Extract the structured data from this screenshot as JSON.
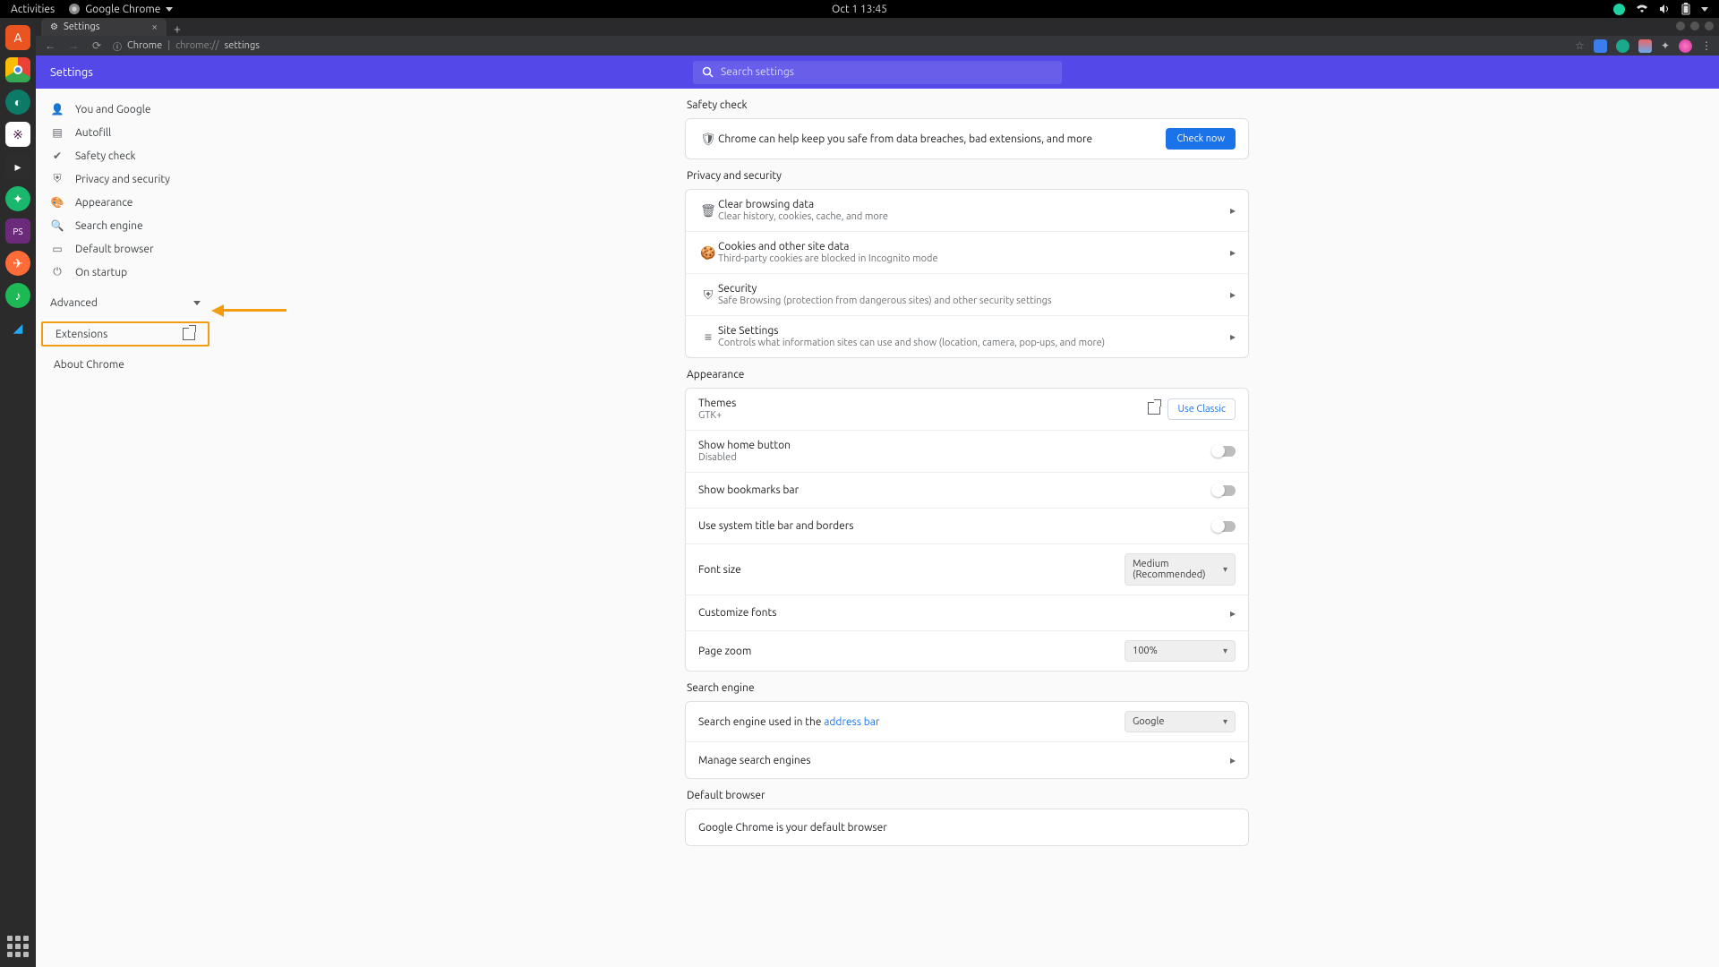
{
  "gnome": {
    "activities": "Activities",
    "app_name": "Google Chrome",
    "clock": "Oct 1  13:45"
  },
  "chrome": {
    "tab_title": "Settings",
    "url_prefix": "Chrome",
    "url_sep": " | ",
    "url_dim": "chrome://",
    "url_path": "settings"
  },
  "settings": {
    "title": "Settings",
    "search_placeholder": "Search settings"
  },
  "sidebar": {
    "items": [
      {
        "label": "You and Google",
        "icon": "person"
      },
      {
        "label": "Autofill",
        "icon": "autofill"
      },
      {
        "label": "Safety check",
        "icon": "shield-check"
      },
      {
        "label": "Privacy and security",
        "icon": "shield"
      },
      {
        "label": "Appearance",
        "icon": "palette"
      },
      {
        "label": "Search engine",
        "icon": "search"
      },
      {
        "label": "Default browser",
        "icon": "browser"
      },
      {
        "label": "On startup",
        "icon": "power"
      }
    ],
    "advanced": "Advanced",
    "extensions": "Extensions",
    "about": "About Chrome"
  },
  "sections": {
    "safety": {
      "title": "Safety check",
      "desc": "Chrome can help keep you safe from data breaches, bad extensions, and more",
      "button": "Check now"
    },
    "privacy": {
      "title": "Privacy and security",
      "rows": [
        {
          "title": "Clear browsing data",
          "sub": "Clear history, cookies, cache, and more",
          "icon": "trash"
        },
        {
          "title": "Cookies and other site data",
          "sub": "Third-party cookies are blocked in Incognito mode",
          "icon": "cookie"
        },
        {
          "title": "Security",
          "sub": "Safe Browsing (protection from dangerous sites) and other security settings",
          "icon": "shield"
        },
        {
          "title": "Site Settings",
          "sub": "Controls what information sites can use and show (location, camera, pop-ups, and more)",
          "icon": "sliders"
        }
      ]
    },
    "appearance": {
      "title": "Appearance",
      "themes_title": "Themes",
      "themes_sub": "GTK+",
      "use_classic": "Use Classic",
      "show_home_title": "Show home button",
      "show_home_sub": "Disabled",
      "show_bookmarks": "Show bookmarks bar",
      "system_title_bar": "Use system title bar and borders",
      "font_size_label": "Font size",
      "font_size_value": "Medium (Recommended)",
      "customize_fonts": "Customize fonts",
      "page_zoom_label": "Page zoom",
      "page_zoom_value": "100%"
    },
    "search": {
      "title": "Search engine",
      "used_in": "Search engine used in the ",
      "address_bar": "address bar",
      "engine_value": "Google",
      "manage": "Manage search engines"
    },
    "default_browser": {
      "title": "Default browser",
      "text": "Google Chrome is your default browser"
    }
  }
}
